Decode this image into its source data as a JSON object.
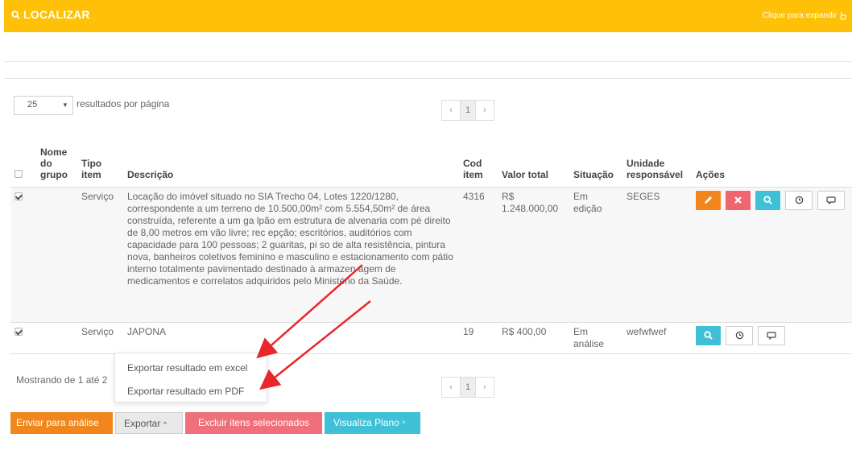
{
  "header": {
    "title": "LOCALIZAR",
    "expand_label": "Clique para expandir",
    "bg_color": "#ffc107"
  },
  "page_size": {
    "value": "25",
    "label": "resultados por página"
  },
  "pager": {
    "prev": "‹",
    "current": "1",
    "next": "›"
  },
  "table": {
    "columns": {
      "nome_grupo": [
        "Nome",
        "do",
        "grupo"
      ],
      "tipo_item": [
        "Tipo",
        "item"
      ],
      "descricao": "Descrição",
      "cod_item": [
        "Cod",
        "item"
      ],
      "valor_total": "Valor total",
      "situacao": "Situação",
      "unidade": [
        "Unidade",
        "responsável"
      ],
      "acoes": "Ações"
    },
    "rows": [
      {
        "checked": true,
        "nome_grupo": "",
        "tipo_item": "Serviço",
        "descricao": "Locação do imóvel situado no SIA Trecho 04, Lotes 1220/1280, correspondente a um terreno de 10.500,00m² com 5.554,50m² de área construída, referente a um ga lpão em estrutura de alvenaria com pé direito de 8,00 metros em vão livre; rec epção; escritórios, auditórios com capacidade para 100 pessoas; 2 guaritas, pi so de alta resistência, pintura nova, banheiros coletivos feminino e masculino e estacionamento com pátio interno totalmente pavimentado destinado à armazen agem de medicamentos e correlatos adquiridos pelo Ministério da Saúde.",
        "cod_item": "4316",
        "valor_total": [
          "R$",
          "1.248.000,00"
        ],
        "situacao": [
          "Em",
          "edição"
        ],
        "unidade": "SEGES",
        "actions": [
          "pencil-icon",
          "close-icon",
          "search-icon",
          "clock-icon",
          "comment-icon"
        ]
      },
      {
        "checked": true,
        "nome_grupo": "",
        "tipo_item": "Serviço",
        "descricao": "JAPONA",
        "cod_item": "19",
        "valor_total": [
          "R$ 400,00"
        ],
        "situacao": [
          "Em",
          "análise"
        ],
        "unidade": "wefwfwef",
        "actions": [
          "search-icon",
          "clock-icon",
          "comment-icon"
        ]
      }
    ]
  },
  "footer": {
    "showing": "Mostrando de 1 até 2",
    "dropdown": {
      "excel": "Exportar resultado em excel",
      "pdf": "Exportar resultado em PDF"
    },
    "buttons": {
      "enviar": "Enviar para análise",
      "exportar": "Exportar",
      "excluir": "Excluir itens selecionados",
      "visualiza": "Visualiza Plano"
    }
  },
  "colors": {
    "orange": "#f0861c",
    "red": "#ef6670",
    "cyan": "#3ec0d6",
    "arrow": "#e8262c"
  }
}
